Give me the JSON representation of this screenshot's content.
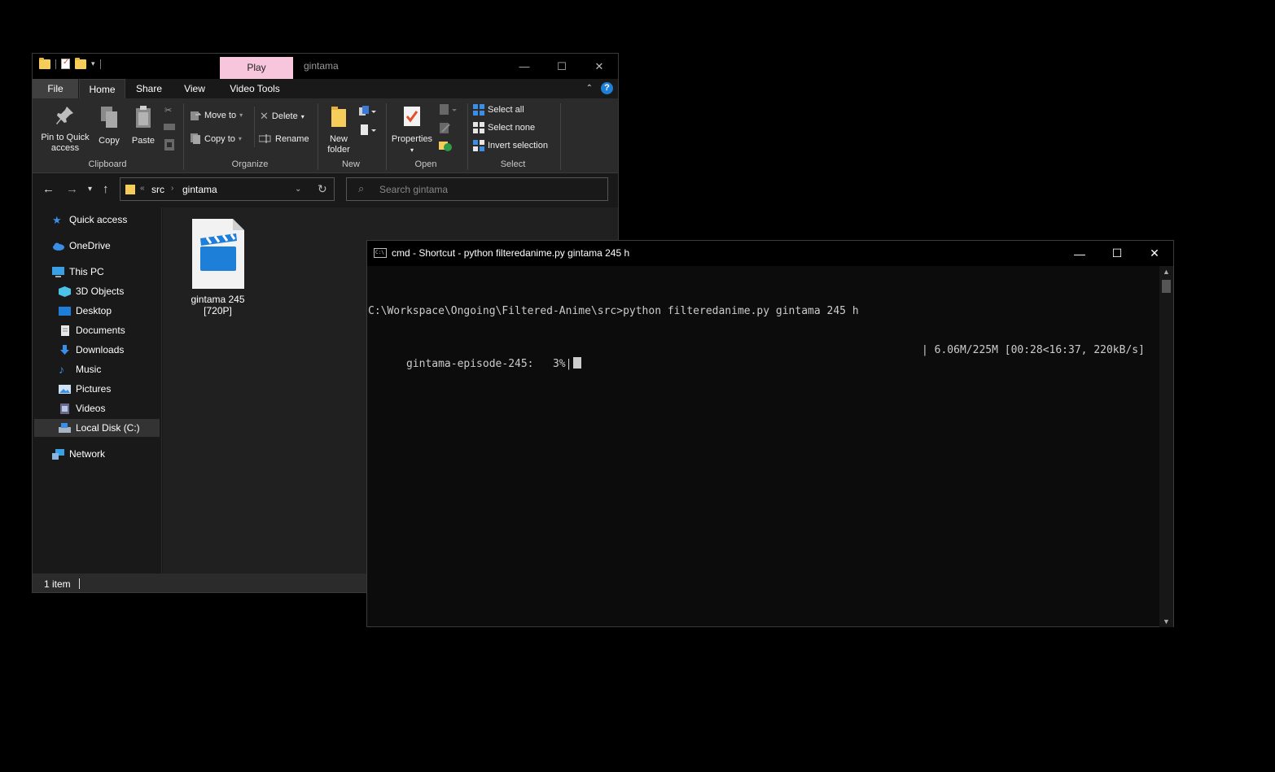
{
  "explorer": {
    "title": "gintama",
    "context_tab": "Play",
    "ribbon_tabs": [
      "File",
      "Home",
      "Share",
      "View",
      "Video Tools"
    ],
    "clipboard": {
      "pin_label_1": "Pin to Quick",
      "pin_label_2": "access",
      "copy": "Copy",
      "paste": "Paste",
      "group": "Clipboard"
    },
    "organize": {
      "move_to": "Move to",
      "copy_to": "Copy to",
      "delete": "Delete",
      "rename": "Rename",
      "group": "Organize"
    },
    "new": {
      "new_folder_1": "New",
      "new_folder_2": "folder",
      "group": "New"
    },
    "open": {
      "properties": "Properties",
      "group": "Open"
    },
    "select": {
      "select_all": "Select all",
      "select_none": "Select none",
      "invert": "Invert selection",
      "group": "Select"
    },
    "address": {
      "crumbs": [
        "src",
        "gintama"
      ],
      "search_placeholder": "Search gintama"
    },
    "nav": {
      "quick_access": "Quick access",
      "onedrive": "OneDrive",
      "this_pc": "This PC",
      "objects3d": "3D Objects",
      "desktop": "Desktop",
      "documents": "Documents",
      "downloads": "Downloads",
      "music": "Music",
      "pictures": "Pictures",
      "videos": "Videos",
      "local_disk": "Local Disk (C:)",
      "network": "Network"
    },
    "files": [
      {
        "name_line1": "gintama 245",
        "name_line2": "[720P]"
      }
    ],
    "status": {
      "count": "1 item"
    }
  },
  "cmd": {
    "title": "cmd - Shortcut - python  filteredanime.py gintama 245 h",
    "line1": "C:\\Workspace\\Ongoing\\Filtered-Anime\\src>python filteredanime.py gintama 245 h",
    "line2_left": "gintama-episode-245:   3%|",
    "line2_right": "| 6.06M/225M [00:28<16:37, 220kB/s]",
    "progress_percent": 3
  },
  "colors": {
    "play_tab": "#f7c5dc",
    "accent_blue": "#1e7fd8",
    "folder": "#f6cd5a"
  }
}
